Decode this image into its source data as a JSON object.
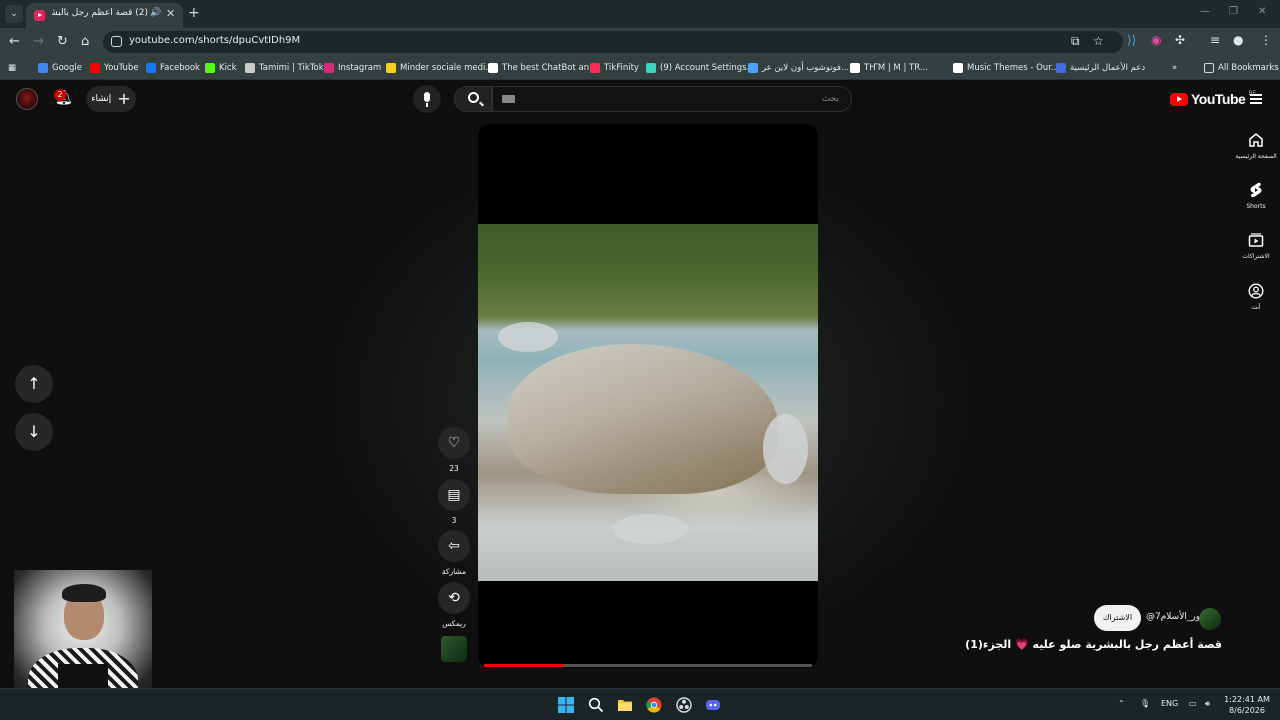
{
  "browser": {
    "tab_menu_glyph": "⌄",
    "tab": {
      "title": "(2) قصة أعظم رجل بالبشرية",
      "favicon": "youtube-icon"
    },
    "new_tab_glyph": "+",
    "close_glyph": "✕",
    "audio_glyph": "🔊",
    "window_controls": {
      "minimize": "—",
      "restore": "❐",
      "close": "✕"
    },
    "url": "youtube.com/shorts/dpuCvtIDh9M",
    "bookmarks": [
      {
        "label": "Google",
        "color": "#4285f4"
      },
      {
        "label": "YouTube",
        "color": "#ff0000"
      },
      {
        "label": "Facebook",
        "color": "#1877f2"
      },
      {
        "label": "Kick",
        "color": "#53fc18"
      },
      {
        "label": "Tamimi | TikTok",
        "color": "#cccccc"
      },
      {
        "label": "Instagram",
        "color": "#d62976"
      },
      {
        "label": "Minder sociale medi...",
        "color": "#f7d21b"
      },
      {
        "label": "The best ChatBot an...",
        "color": "#ffffff"
      },
      {
        "label": "TikFinity",
        "color": "#fe2c55"
      },
      {
        "label": "(9) Account Settings...",
        "color": "#3ad4c0"
      },
      {
        "label": "فوتوشوب أون لاين عر...",
        "color": "#4aa3ff"
      },
      {
        "label": "TҤΜ | M | ТR...",
        "color": "#ffffff"
      },
      {
        "label": "Music Themes - Our...",
        "color": "#ffffff"
      },
      {
        "label": "دعم الأعمال الرئيسية",
        "color": "#3f6de0"
      }
    ],
    "bookmarks_overflow": "»",
    "all_bookmarks": "All Bookmarks"
  },
  "youtube": {
    "notifications_count": "2",
    "create_label": "إنشاء",
    "search_placeholder": "بحث",
    "logo_text": "YouTube",
    "country_code": "BE",
    "guide": [
      {
        "label": "الصفحة الرئيسية",
        "icon": "home-icon"
      },
      {
        "label": "Shorts",
        "icon": "shorts-icon"
      },
      {
        "label": "الاشتراكات",
        "icon": "subscriptions-icon"
      },
      {
        "label": "أنت",
        "icon": "you-icon"
      }
    ],
    "short": {
      "likes": "23",
      "comments": "3",
      "share_label": "مشاركة",
      "remix_label": "ريمكس",
      "progress": 0.24,
      "subscribe_label": "الاشتراك",
      "channel_handle": "@نور_الأسلام7",
      "title": "قصة أعظم رجل بالبشرية صلو عليه 💗 الجزء(1)"
    }
  },
  "taskbar": {
    "tray_language": "ENG",
    "time": "1:22:41 AM",
    "date": "8/6/2026"
  }
}
